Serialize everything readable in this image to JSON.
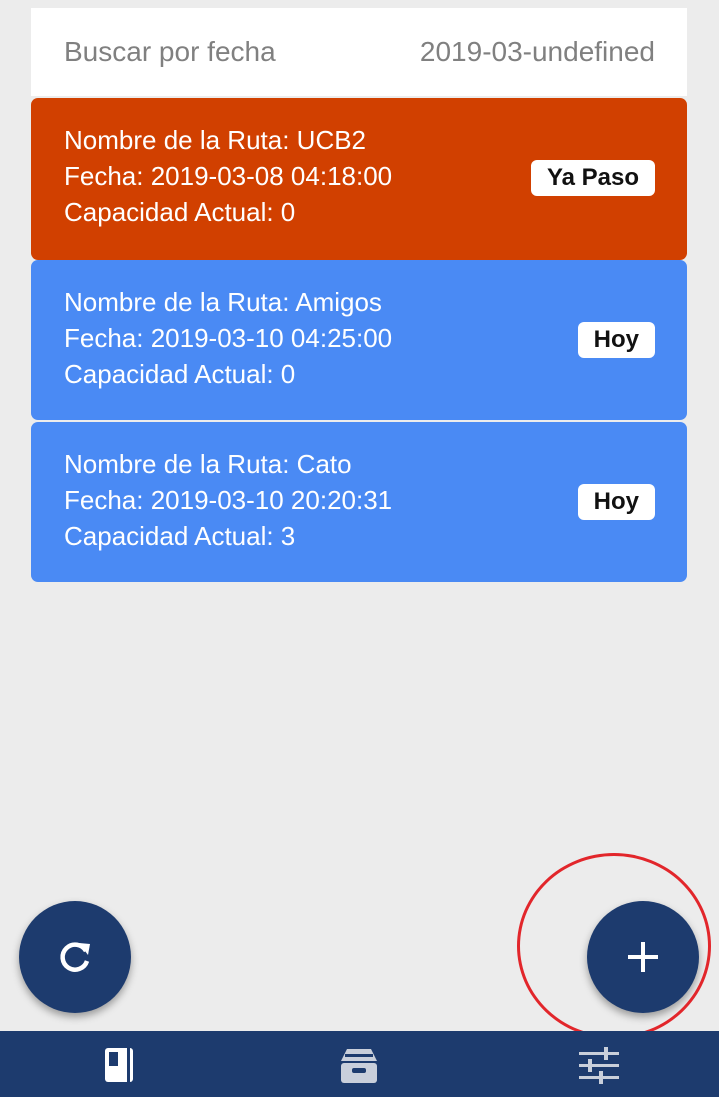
{
  "search": {
    "label": "Buscar por fecha",
    "value": "2019-03-undefined"
  },
  "routes": [
    {
      "name_line": "Nombre de la Ruta: UCB2",
      "date_line": "Fecha: 2019-03-08 04:18:00",
      "capacity_line": "Capacidad Actual: 0",
      "status": "Ya Paso",
      "color": "#d14000"
    },
    {
      "name_line": "Nombre de la Ruta: Amigos",
      "date_line": "Fecha: 2019-03-10 04:25:00",
      "capacity_line": "Capacidad Actual: 0",
      "status": "Hoy",
      "color": "#4a8af4"
    },
    {
      "name_line": "Nombre de la Ruta: Cato",
      "date_line": "Fecha: 2019-03-10 20:20:31",
      "capacity_line": "Capacidad Actual: 3",
      "status": "Hoy",
      "color": "#4a8af4"
    }
  ],
  "fabs": {
    "refresh_icon": "refresh-icon",
    "add_icon": "plus-icon",
    "color": "#1d3b6e"
  },
  "annotation": {
    "highlight_color": "#e2262b"
  },
  "bottom_nav": {
    "color": "#1d3b6e",
    "items": [
      {
        "icon": "book-icon"
      },
      {
        "icon": "archive-icon"
      },
      {
        "icon": "sliders-icon"
      }
    ]
  }
}
